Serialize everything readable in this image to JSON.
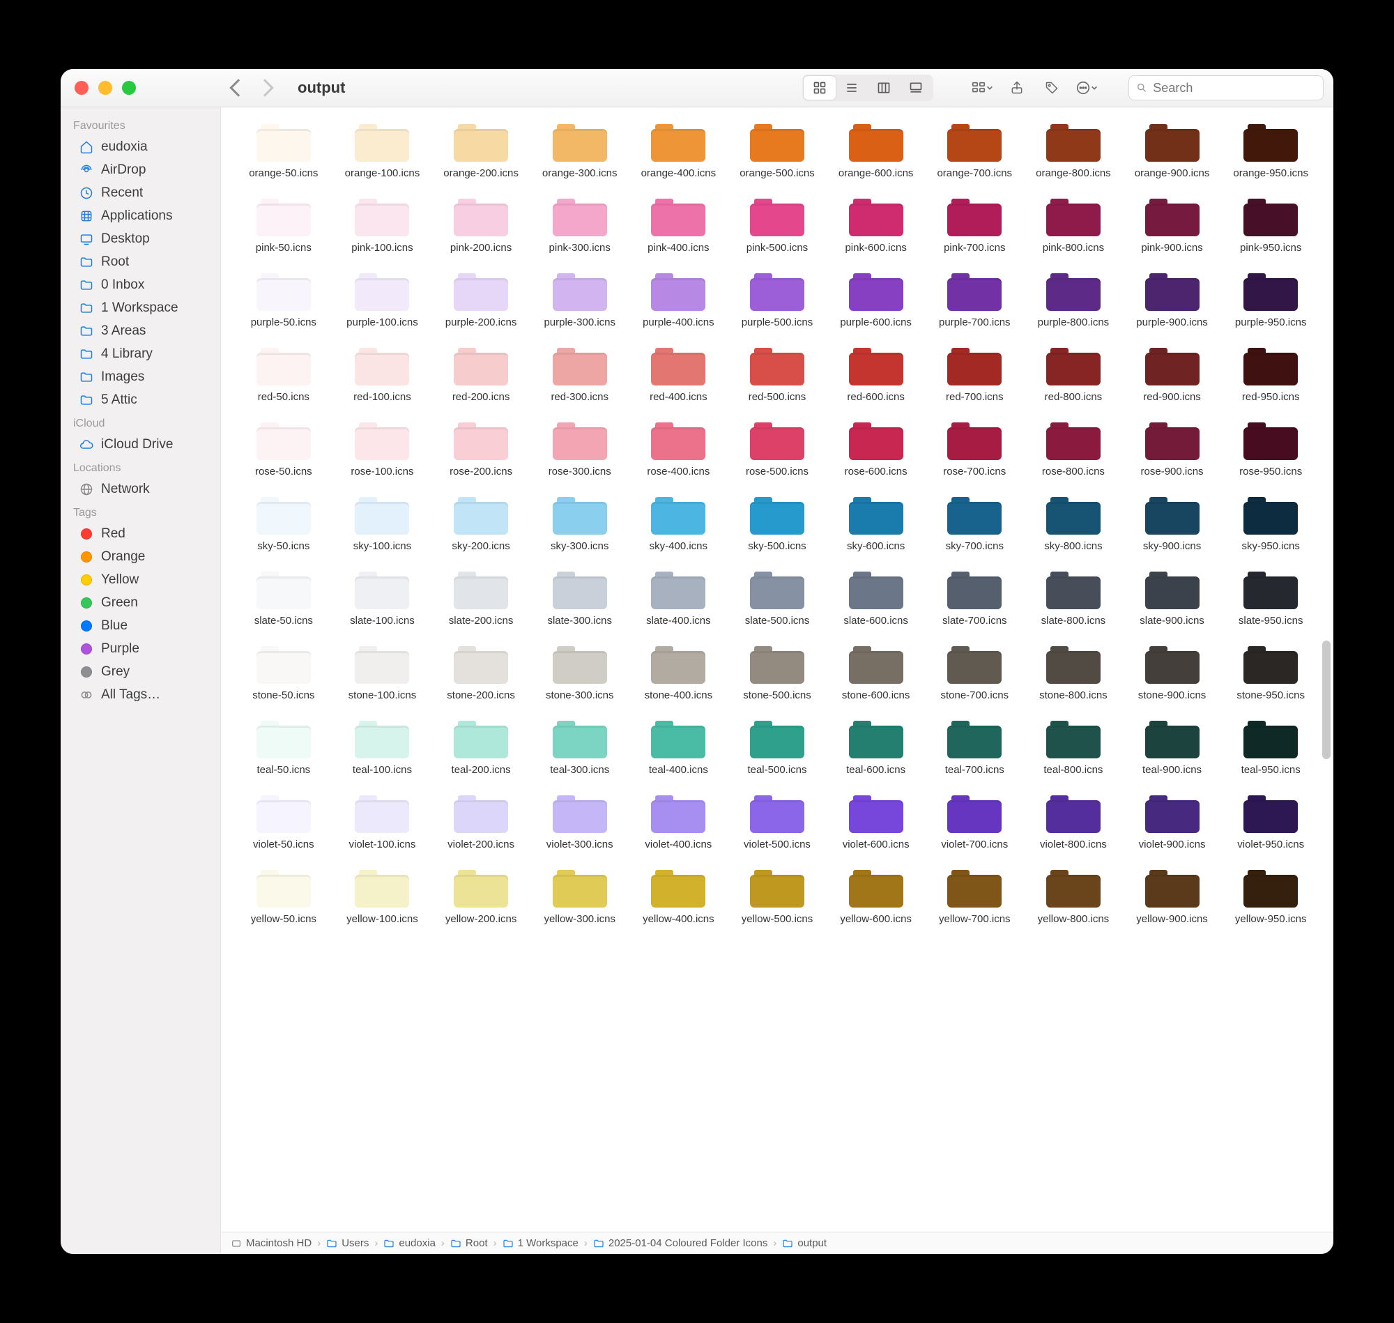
{
  "window_title": "output",
  "search_placeholder": "Search",
  "sidebar": {
    "sections": [
      {
        "label": "Favourites",
        "items": [
          {
            "icon": "home",
            "label": "eudoxia"
          },
          {
            "icon": "airdrop",
            "label": "AirDrop"
          },
          {
            "icon": "clock",
            "label": "Recent"
          },
          {
            "icon": "apps",
            "label": "Applications"
          },
          {
            "icon": "desktop",
            "label": "Desktop"
          },
          {
            "icon": "folder",
            "label": "Root"
          },
          {
            "icon": "folder",
            "label": "0 Inbox"
          },
          {
            "icon": "folder",
            "label": "1 Workspace"
          },
          {
            "icon": "folder",
            "label": "3 Areas"
          },
          {
            "icon": "folder",
            "label": "4 Library"
          },
          {
            "icon": "folder",
            "label": "Images"
          },
          {
            "icon": "folder",
            "label": "5 Attic"
          }
        ]
      },
      {
        "label": "iCloud",
        "items": [
          {
            "icon": "cloud",
            "label": "iCloud Drive"
          }
        ]
      },
      {
        "label": "Locations",
        "items": [
          {
            "icon": "network",
            "label": "Network"
          }
        ]
      },
      {
        "label": "Tags",
        "items": [
          {
            "icon": "tag",
            "color": "#ff3b30",
            "label": "Red"
          },
          {
            "icon": "tag",
            "color": "#ff9500",
            "label": "Orange"
          },
          {
            "icon": "tag",
            "color": "#ffcc00",
            "label": "Yellow"
          },
          {
            "icon": "tag",
            "color": "#34c759",
            "label": "Green"
          },
          {
            "icon": "tag",
            "color": "#007aff",
            "label": "Blue"
          },
          {
            "icon": "tag",
            "color": "#af52de",
            "label": "Purple"
          },
          {
            "icon": "tag",
            "color": "#8e8e93",
            "label": "Grey"
          },
          {
            "icon": "alltags",
            "label": "All Tags…"
          }
        ]
      }
    ]
  },
  "pathbar": [
    {
      "icon": "disk",
      "label": "Macintosh HD"
    },
    {
      "icon": "folder",
      "label": "Users"
    },
    {
      "icon": "folder",
      "label": "eudoxia"
    },
    {
      "icon": "folder",
      "label": "Root"
    },
    {
      "icon": "folder",
      "label": "1 Workspace"
    },
    {
      "icon": "folder",
      "label": "2025-01-04 Coloured Folder Icons"
    },
    {
      "icon": "folder",
      "label": "output"
    }
  ],
  "shades": [
    "50",
    "100",
    "200",
    "300",
    "400",
    "500",
    "600",
    "700",
    "800",
    "900",
    "950"
  ],
  "palettes": {
    "orange": [
      "#fdf7ed",
      "#fbeccf",
      "#f7d9a4",
      "#f3b866",
      "#ee9537",
      "#e77a1f",
      "#d96015",
      "#b44715",
      "#8f3919",
      "#733018",
      "#42180b"
    ],
    "pink": [
      "#fdf2f7",
      "#fbe6f0",
      "#f8cfe2",
      "#f4a7ca",
      "#ee72aa",
      "#e4478c",
      "#cf2c6f",
      "#b01d58",
      "#8f1b4a",
      "#761a40",
      "#481028"
    ],
    "purple": [
      "#f9f5fd",
      "#f2eafb",
      "#e6d6f7",
      "#d2b5f0",
      "#b789e5",
      "#9d5fd7",
      "#8740c1",
      "#7231a5",
      "#5e2a87",
      "#4d256e",
      "#311647"
    ],
    "red": [
      "#fdf3f3",
      "#fbe5e4",
      "#f6cdcc",
      "#eea6a4",
      "#e47672",
      "#d84f4a",
      "#c43530",
      "#a32925",
      "#862524",
      "#6f2423",
      "#3f1111"
    ],
    "rose": [
      "#fef3f4",
      "#fce6e9",
      "#f9ced5",
      "#f4a5b3",
      "#ec718a",
      "#de4168",
      "#c72751",
      "#a71c43",
      "#8b1b3e",
      "#741b39",
      "#470c1f"
    ],
    "sky": [
      "#f1f8fd",
      "#e2f1fb",
      "#c1e4f6",
      "#8acfee",
      "#4cb5e2",
      "#2699cd",
      "#1a7bad",
      "#17638d",
      "#175373",
      "#18455f",
      "#0e2c40"
    ],
    "slate": [
      "#f7f8fa",
      "#eef0f3",
      "#e1e5ea",
      "#c9d0d9",
      "#a7b1bf",
      "#8692a4",
      "#6b7788",
      "#565f6e",
      "#474e5a",
      "#3c424b",
      "#25282f"
    ],
    "stone": [
      "#f9f8f7",
      "#f1efed",
      "#e4e1dd",
      "#d0ccc6",
      "#b1aba2",
      "#938b80",
      "#776f64",
      "#615a51",
      "#514b44",
      "#443f3a",
      "#2a2724"
    ],
    "teal": [
      "#effbf7",
      "#d6f4ec",
      "#aee8da",
      "#7bd5c2",
      "#4abca6",
      "#2fa08c",
      "#247f71",
      "#20665c",
      "#1e524b",
      "#1c433e",
      "#0e2926"
    ],
    "violet": [
      "#f6f4fe",
      "#ede9fd",
      "#ddd6fb",
      "#c4b6f7",
      "#a78ef1",
      "#8b66e8",
      "#7746db",
      "#6636c0",
      "#552e9d",
      "#47297f",
      "#2d1853"
    ],
    "yellow": [
      "#fbfaea",
      "#f5f2c9",
      "#ece396",
      "#dfcb56",
      "#d2b22c",
      "#bf981f",
      "#a17618",
      "#805618",
      "#6a451b",
      "#5b3a1c",
      "#351f0d"
    ]
  },
  "row_order": [
    "orange",
    "pink",
    "purple",
    "red",
    "rose",
    "sky",
    "slate",
    "stone",
    "teal",
    "violet",
    "yellow"
  ]
}
